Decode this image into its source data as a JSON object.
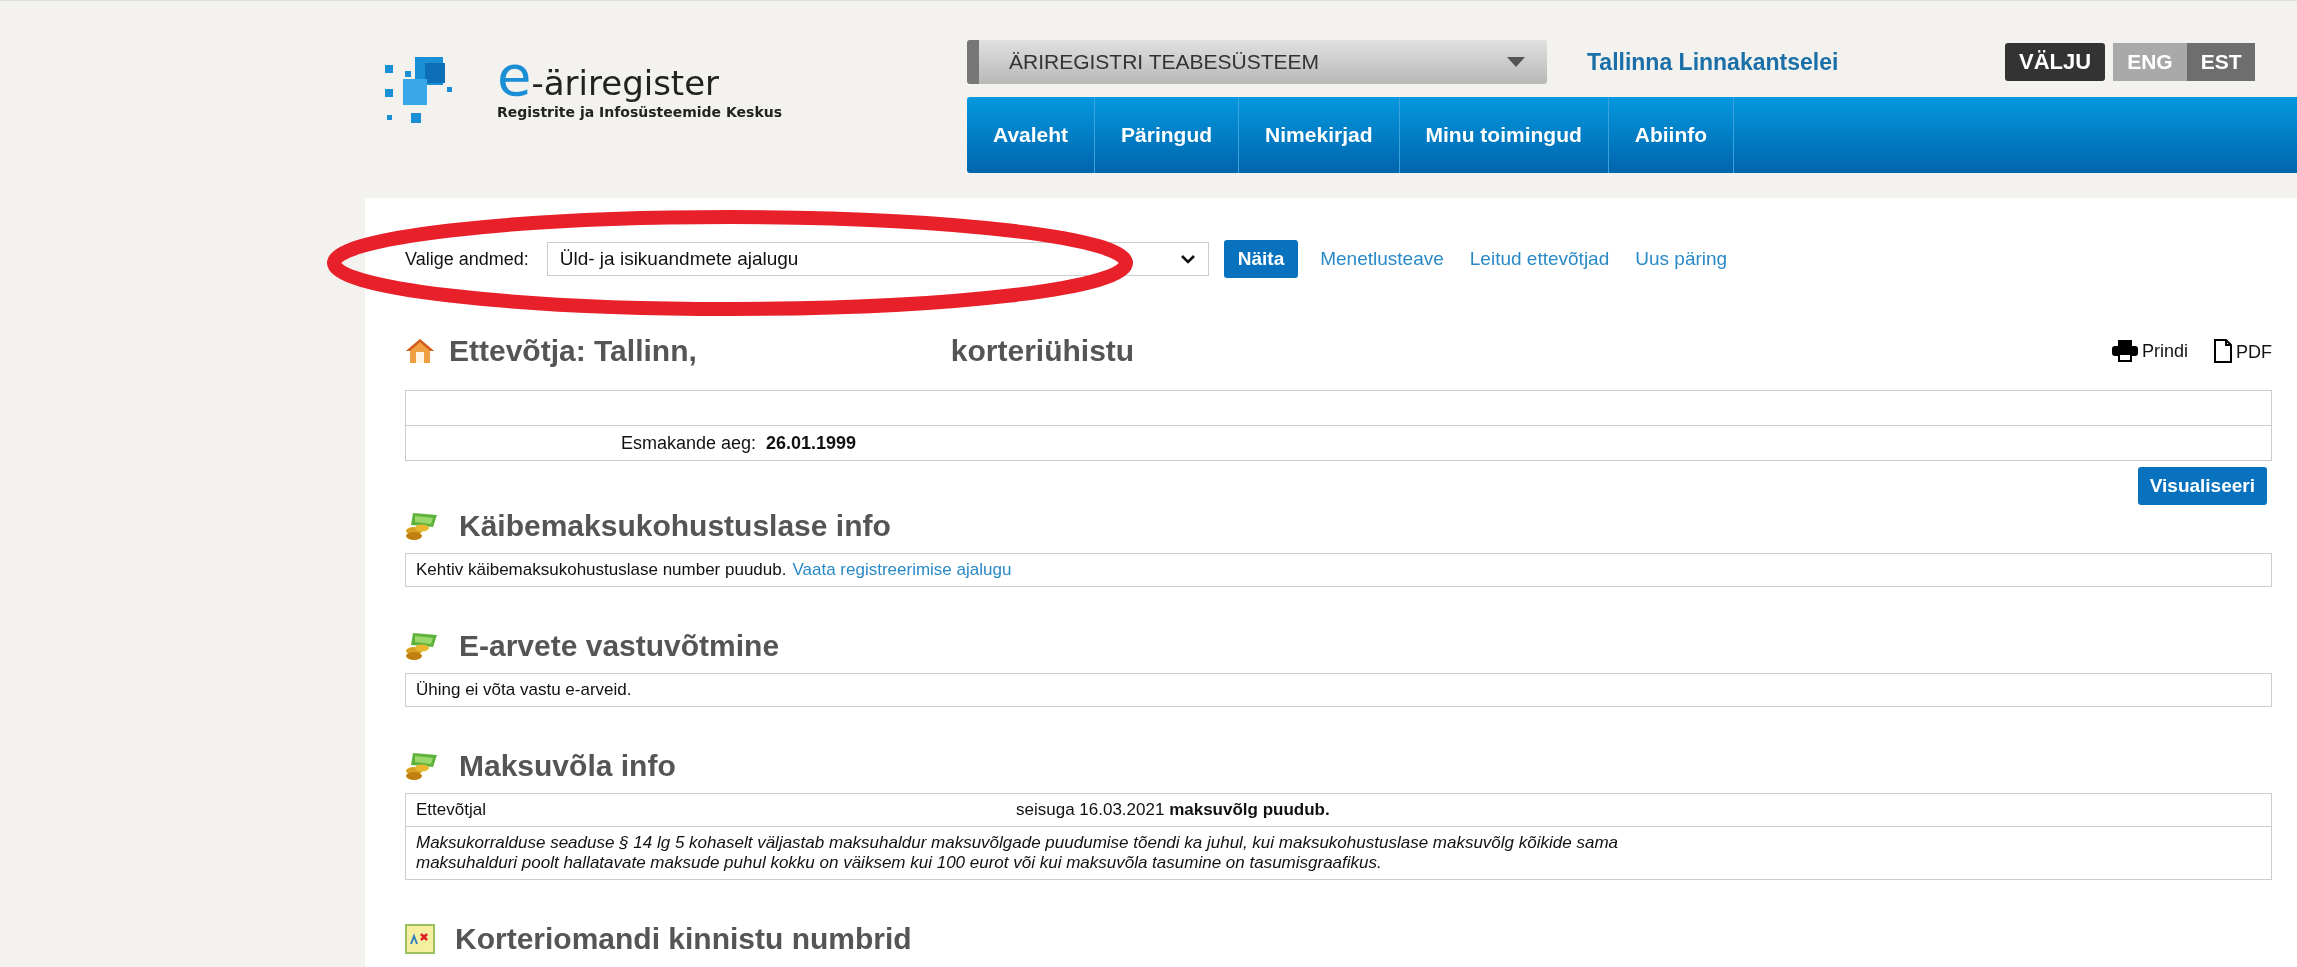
{
  "header": {
    "logo": {
      "mark": "e",
      "name": "-äriregister",
      "subtitle": "Registrite ja Infosüsteemide Keskus"
    },
    "system_dropdown": "ÄRIREGISTRI TEABESÜSTEEM",
    "user": "Tallinna Linnakantselei",
    "logout": "VÄLJU",
    "languages": [
      {
        "label": "ENG",
        "selected": false
      },
      {
        "label": "EST",
        "selected": true
      }
    ],
    "nav": [
      "Avaleht",
      "Päringud",
      "Nimekirjad",
      "Minu toimingud",
      "Abiinfo"
    ]
  },
  "form": {
    "label": "Valige andmed:",
    "value": "Üld- ja isikuandmete ajalugu",
    "button": "Näita",
    "links": [
      "Menetlusteave",
      "Leitud ettevõtjad",
      "Uus päring"
    ]
  },
  "company": {
    "title": "Ettevõtja: Tallinn,",
    "title_end": "korteriühistu",
    "actions": [
      {
        "kind": "print",
        "label": "Prindi"
      },
      {
        "kind": "pdf",
        "label": "PDF"
      }
    ],
    "first_entry": {
      "label": "Esmakande aeg:",
      "value": "26.01.1999"
    },
    "visualize_button": "Visualiseeri"
  },
  "sections": [
    {
      "kind": "text",
      "title": "Käibemaksukohustuslase info",
      "text": "Kehtiv käibemaksukohustuslase number puudub.",
      "link": "Vaata registreerimise ajalugu"
    },
    {
      "kind": "text",
      "title": "E-arvete vastuvõtmine",
      "text": "Ühing ei võta vastu e-arveid."
    },
    {
      "kind": "debt",
      "title": "Maksuvõla info",
      "subject": "Ettevõtjal",
      "status": "seisuga 16.03.2021 **maksuvõlg puudub.**",
      "note": "Maksukorralduse seaduse § 14 lg 5 kohaselt väljastab maksuhaldur maksuvõlgade puudumise tõendi ka juhul, kui maksukohustuslase maksuvõlg kõikide sama maksuhalduri poolt hallatavate maksude puhul kokku on väiksem kui 100 eurot või kui maksuvõla tasumine on tasumisgraafikus."
    },
    {
      "kind": "heading",
      "title": "Korteriomandi kinnistu numbrid"
    }
  ],
  "annotation": {
    "kind": "ellipse"
  }
}
